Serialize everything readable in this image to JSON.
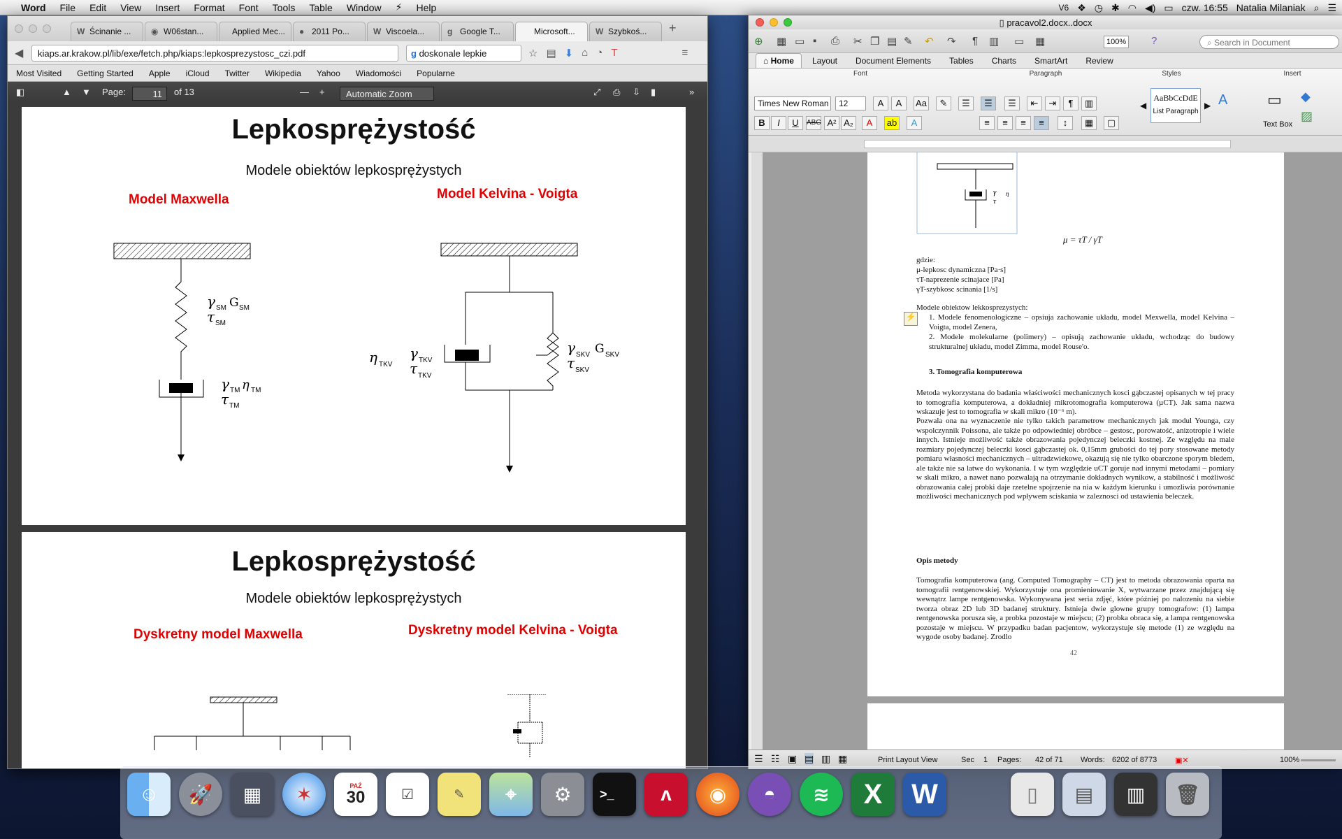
{
  "menubar": {
    "app": "Word",
    "items": [
      "File",
      "Edit",
      "View",
      "Insert",
      "Format",
      "Font",
      "Tools",
      "Table",
      "Window",
      "Help"
    ],
    "clock": "czw. 16:55",
    "user": "Natalia Milaniak",
    "status_label": "V6"
  },
  "firefox": {
    "tabs": [
      {
        "fav": "W",
        "label": "Ścinanie ..."
      },
      {
        "fav": "◉",
        "label": "W06stan..."
      },
      {
        "fav": "",
        "label": "Applied Mec..."
      },
      {
        "fav": "●",
        "label": "2011 Po..."
      },
      {
        "fav": "W",
        "label": "Viscoela..."
      },
      {
        "fav": "g",
        "label": "Google T..."
      },
      {
        "fav": "",
        "label": "Microsoft..."
      },
      {
        "fav": "W",
        "label": "Szybkoś..."
      }
    ],
    "url": "kiaps.ar.krakow.pl/lib/exe/fetch.php/kiaps:lepkosprezystosc_czi.pdf",
    "search_value": "doskonale lepkie",
    "bookmarks": [
      "Most Visited",
      "Getting Started",
      "Apple",
      "iCloud",
      "Twitter",
      "Wikipedia",
      "Yahoo",
      "Wiadomości",
      "Popularne"
    ],
    "pdf": {
      "page_label": "Page:",
      "page": "11",
      "of": "of 13",
      "zoom": "Automatic Zoom"
    }
  },
  "slide1": {
    "title": "Lepkosprężystość",
    "subtitle": "Modele obiektów lepkosprężystych",
    "left_heading": "Model Maxwella",
    "right_heading": "Model Kelvina - Voigta"
  },
  "slide2": {
    "title": "Lepkosprężystość",
    "subtitle": "Modele obiektów lepkosprężystych",
    "left_heading": "Dyskretny model Maxwella",
    "right_heading": "Dyskretny model Kelvina - Voigta"
  },
  "word": {
    "title": "pracavol2.docx..docx",
    "search_placeholder": "Search in Document",
    "zoom": "100%",
    "ribbon_tabs": [
      "Home",
      "Layout",
      "Document Elements",
      "Tables",
      "Charts",
      "SmartArt",
      "Review"
    ],
    "groups": [
      "Font",
      "Paragraph",
      "Styles",
      "Insert"
    ],
    "font_name": "Times New Roman",
    "font_size": "12",
    "style_sample": "AaBbCcDdE",
    "style_name": "List Paragraph",
    "textbox_label": "Text Box",
    "doc": {
      "formula": "μ = τT / γT",
      "gdzie": "gdzie:",
      "def1": "μ-lepkosc dynamiczna [Pa·s]",
      "def2": "τT-naprezenie scinajace [Pa]",
      "def3": "γT-szybkosc scinania [1/s]",
      "models_intro": "Modele obiektow lekkosprezystych:",
      "list1": "1. Modele fenomenologiczne – opsiuja zachowanie układu, model Mexwella, model Kelvina – Voigta, model Zenera,",
      "list2": "2. Modele molekularne (polimery) – opisują zachowanie układu, wchodząc do budowy strukturalnej układu, model Zimma, model Rouse'o.",
      "heading3": "3.  Tomografia komputerowa",
      "para1": "Metoda wykorzystana do badania właściwości mechanicznych kosci gąbczastej opisanych w tej pracy to tomografia komputerowa, a dokładniej mikrotomografia komputerowa (µCT). Jak sama nazwa wskazuje jest to tomografia w skali mikro (10⁻⁶ m).",
      "para2": "Pozwala ona na wyznaczenie nie tylko takich parametrow mechanicznych jak modul Younga, czy wspolczynnik Poissona, ale także po odpowiedniej obróbce – gestosc, porowatość, anizotropie i wiele innych. Istnieje możliwość także obrazowania pojedynczej beleczki kostnej. Ze względu na male rozmiary pojedynczej beleczki kosci gąbczastej ok. 0,15mm grubości do tej pory stosowane metody pomiaru własności mechanicznych – ultradzwiekowe, okazują się nie tylko obarczone sporym bledem, ale także nie sa latwe do wykonania. I w tym względzie uCT goruje nad innymi metodami – pomiary w skali mikro, a nawet nano pozwalają na otrzymanie dokładnych wynikow, a stabilność i możliwość obrazowania całej probki daje rzetelne spojrzenie na nia w każdym kierunku i umozliwia porównanie możliwości mechanicznych pod wpływem sciskania w zaleznosci od ustawienia beleczek.",
      "opis": "Opis metody",
      "para3": "Tomografia komputerowa (ang. Computed Tomography – CT) jest to metoda obrazowania oparta na tomografii rentgenowskiej. Wykorzystuje ona promieniowanie X, wytwarzane przez znajdującą się wewnątrz lampe rentgenowska. Wykonywana jest seria zdjęć, które później po nalozeniu na siebie tworza obraz 2D lub 3D badanej struktury. Istnieja dwie glowne grupy tomografow: (1) lampa rentgenowska porusza się, a probka pozostaje w miejscu; (2) probka obraca się, a lampa rentgenowska pozostaje w miejscu. W przypadku badan pacjentow, wykorzystuje się metode (1) ze względu na wygode osoby badanej. Zrodlo",
      "page_no": "42"
    },
    "status": {
      "view": "Print Layout View",
      "sec_label": "Sec",
      "sec": "1",
      "pages_label": "Pages:",
      "pages": "42 of 71",
      "words_label": "Words:",
      "words": "6202 of 8773",
      "zoom": "100%"
    }
  },
  "dock": [
    "Finder",
    "Launchpad",
    "Photos",
    "Safari",
    "Calendar",
    "Reminders",
    "Stickies",
    "Maps",
    "System Preferences",
    "Terminal",
    "Adobe Acrobat",
    "Firefox",
    "GitHub",
    "Spotify",
    "Excel",
    "Word",
    "Preview",
    "Downloads",
    "Documents",
    "Trash"
  ],
  "dock_calendar": {
    "month": "PAŹ",
    "day": "30"
  }
}
